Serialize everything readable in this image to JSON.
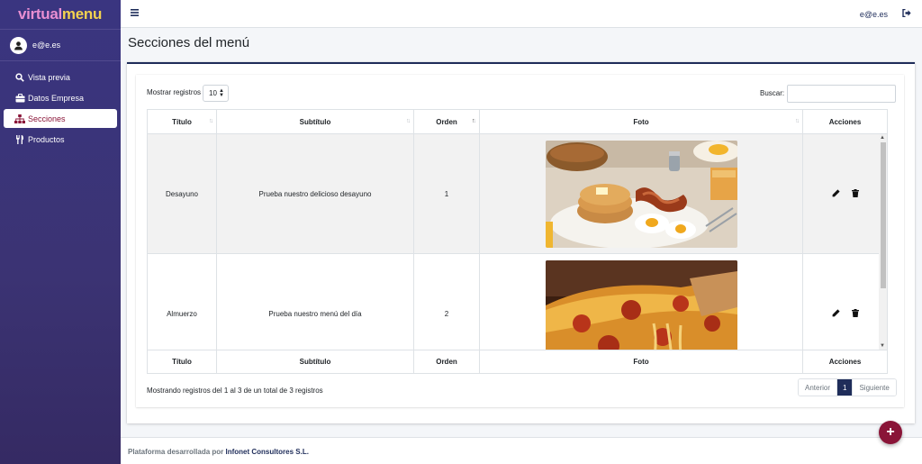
{
  "brand": {
    "part1": "virtual",
    "part2": "menu"
  },
  "user": {
    "email": "e@e.es"
  },
  "topbar": {
    "email": "e@e.es"
  },
  "sidebar": {
    "items": [
      {
        "label": "Vista previa",
        "icon": "search-icon"
      },
      {
        "label": "Datos Empresa",
        "icon": "briefcase-icon"
      },
      {
        "label": "Secciones",
        "icon": "sitemap-icon",
        "active": true
      },
      {
        "label": "Productos",
        "icon": "utensils-icon"
      }
    ]
  },
  "page": {
    "title": "Secciones del menú"
  },
  "table": {
    "length_label": "Mostrar registros",
    "length_value": "10",
    "search_label": "Buscar:",
    "search_value": "",
    "columns": [
      "Título",
      "Subtítulo",
      "Orden",
      "Foto",
      "Acciones"
    ],
    "rows": [
      {
        "titulo": "Desayuno",
        "subtitulo": "Prueba nuestro delicioso desayuno",
        "orden": "1",
        "foto": "breakfast-photo"
      },
      {
        "titulo": "Almuerzo",
        "subtitulo": "Prueba nuestro menú del día",
        "orden": "2",
        "foto": "pizza-photo"
      }
    ],
    "info": "Mostrando registros del 1 al 3 de un total de 3 registros",
    "pagination": {
      "prev": "Anterior",
      "current": "1",
      "next": "Siguiente"
    }
  },
  "footer": {
    "text": "Plataforma desarrollada por",
    "company": "Infonet Consultores S.L."
  },
  "colors": {
    "sidebar": "#3a3580",
    "accent": "#8a1538",
    "primary": "#1f2d5a"
  }
}
